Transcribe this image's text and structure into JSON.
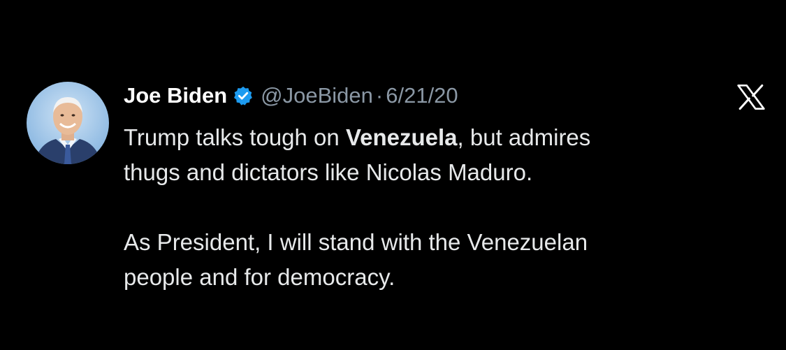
{
  "tweet": {
    "author": {
      "name": "Joe Biden",
      "handle": "@JoeBiden",
      "verified_icon": "verified-badge-icon",
      "avatar": "avatar-photo"
    },
    "separator": "·",
    "date": "6/21/20",
    "platform_icon": "x-logo-icon",
    "text": {
      "line1_start": "Trump talks tough on ",
      "line1_bold": "Venezuela",
      "line1_end": ", but admires",
      "line2": "thugs and dictators like Nicolas Maduro.",
      "para2_line1": "As President, I will stand with the Venezuelan",
      "para2_line2": "people and for democracy."
    }
  },
  "colors": {
    "background": "#000000",
    "name": "#ffffff",
    "secondary_text": "#8b98a5",
    "body_text": "#e7e9ea",
    "verified_badge": "#1d9bf0"
  }
}
